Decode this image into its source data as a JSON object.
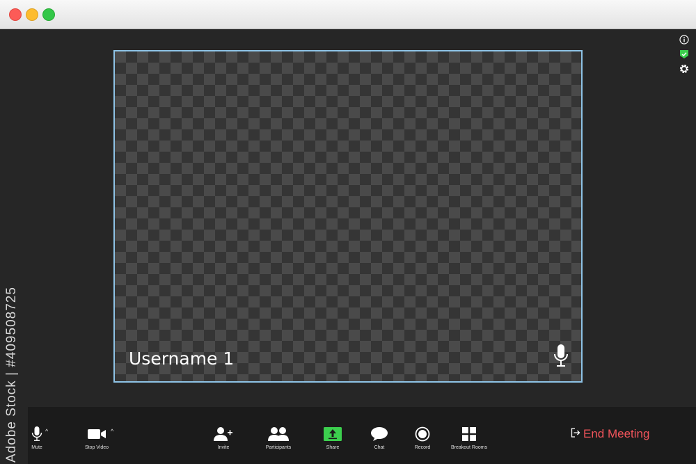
{
  "window": {
    "controls": [
      "close",
      "minimize",
      "maximize"
    ]
  },
  "side_icons": [
    "info-icon",
    "shield-check-icon",
    "gear-icon"
  ],
  "video_tile": {
    "username": "Username 1",
    "mic_icon": "microphone-icon"
  },
  "watermark": {
    "text": "Adobe Stock | #409508725"
  },
  "toolbar": {
    "mute_label": "Mute",
    "stop_video_label": "Stop Video",
    "invite_label": "Invite",
    "participants_label": "Participants",
    "share_label": "Share",
    "chat_label": "Chat",
    "record_label": "Record",
    "breakout_rooms_label": "Breakout Rooms",
    "end_meeting_label": "End Meeting",
    "caret_symbol": "^"
  },
  "colors": {
    "accent_border": "#8ec3e6",
    "share_green": "#3ccf4e",
    "end_meeting_red": "#f2545b",
    "shield_green": "#3ccf4e"
  }
}
